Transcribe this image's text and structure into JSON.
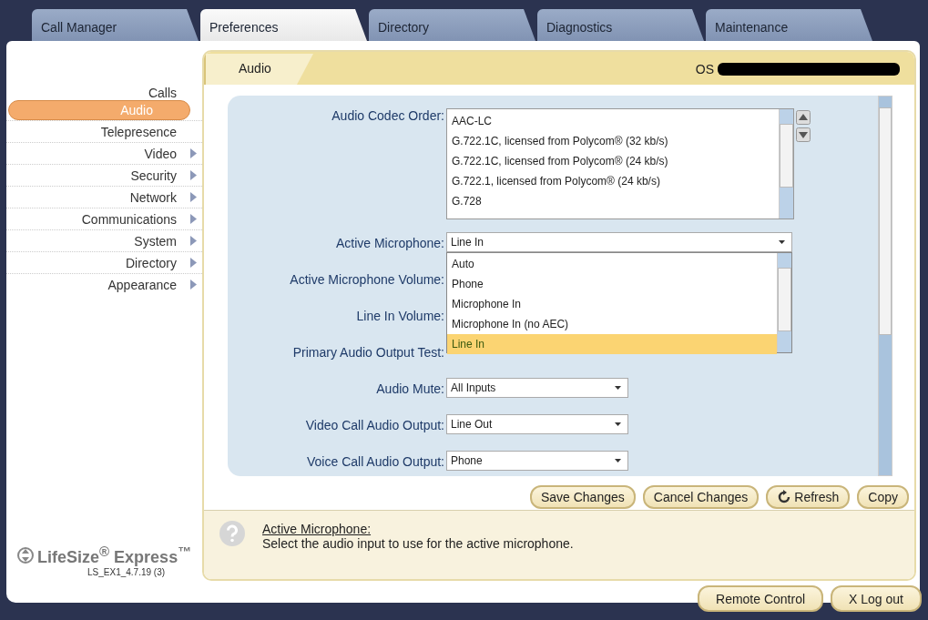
{
  "tabs": [
    {
      "label": "Call Manager",
      "selected": false
    },
    {
      "label": "Preferences",
      "selected": true
    },
    {
      "label": "Directory",
      "selected": false
    },
    {
      "label": "Diagnostics",
      "selected": false
    },
    {
      "label": "Maintenance",
      "selected": false
    }
  ],
  "sidebar": {
    "items": [
      {
        "label": "Calls",
        "selected": false,
        "has_submenu": false
      },
      {
        "label": "Audio",
        "selected": true,
        "has_submenu": false
      },
      {
        "label": "Telepresence",
        "selected": false,
        "has_submenu": false
      },
      {
        "label": "Video",
        "selected": false,
        "has_submenu": true
      },
      {
        "label": "Security",
        "selected": false,
        "has_submenu": true
      },
      {
        "label": "Network",
        "selected": false,
        "has_submenu": true
      },
      {
        "label": "Communications",
        "selected": false,
        "has_submenu": true
      },
      {
        "label": "System",
        "selected": false,
        "has_submenu": true
      },
      {
        "label": "Directory",
        "selected": false,
        "has_submenu": true
      },
      {
        "label": "Appearance",
        "selected": false,
        "has_submenu": true
      }
    ]
  },
  "logo": {
    "text": "LifeSize$^{®}$ Express$^{™}$",
    "version": "LS_EX1_4.7.19 (3)"
  },
  "header": {
    "section_tab": "Audio",
    "os_label": "OS"
  },
  "form": [
    {
      "kind": "listbox",
      "label": "Audio Codec Order:",
      "options": [
        "AAC-LC",
        "G.722.1C, licensed from Polycom® (32 kb/s)",
        "G.722.1C, licensed from Polycom® (24 kb/s)",
        "G.722.1, licensed from Polycom® (24 kb/s)",
        "G.728"
      ]
    },
    {
      "kind": "dropdown_open",
      "label": "Active Microphone:",
      "value": "Line In",
      "options": [
        {
          "label": "Auto",
          "selected": false
        },
        {
          "label": "Phone",
          "selected": false
        },
        {
          "label": "Microphone In",
          "selected": false
        },
        {
          "label": "Microphone In (no AEC)",
          "selected": false
        },
        {
          "label": "Line In",
          "selected": true
        }
      ]
    },
    {
      "kind": "covered",
      "label": "Active Microphone Volume:"
    },
    {
      "kind": "covered",
      "label": "Line In Volume:"
    },
    {
      "kind": "covered",
      "label": "Primary Audio Output Test:"
    },
    {
      "kind": "select",
      "label": "Audio Mute:",
      "value": "All Inputs"
    },
    {
      "kind": "select",
      "label": "Video Call Audio Output:",
      "value": "Line Out"
    },
    {
      "kind": "select",
      "label": "Voice Call Audio Output:",
      "value": "Phone"
    }
  ],
  "actions": [
    {
      "label": "Save Changes",
      "kind": "plain"
    },
    {
      "label": "Cancel Changes",
      "kind": "plain"
    },
    {
      "label": "Refresh",
      "kind": "refresh"
    },
    {
      "label": "Copy",
      "kind": "plain"
    }
  ],
  "help": {
    "title": "Active Microphone:",
    "text": "Select the audio input to use for the active microphone."
  },
  "footer_buttons": [
    {
      "label": "Remote Control"
    },
    {
      "label": "Log out",
      "icon_char": "X"
    }
  ]
}
